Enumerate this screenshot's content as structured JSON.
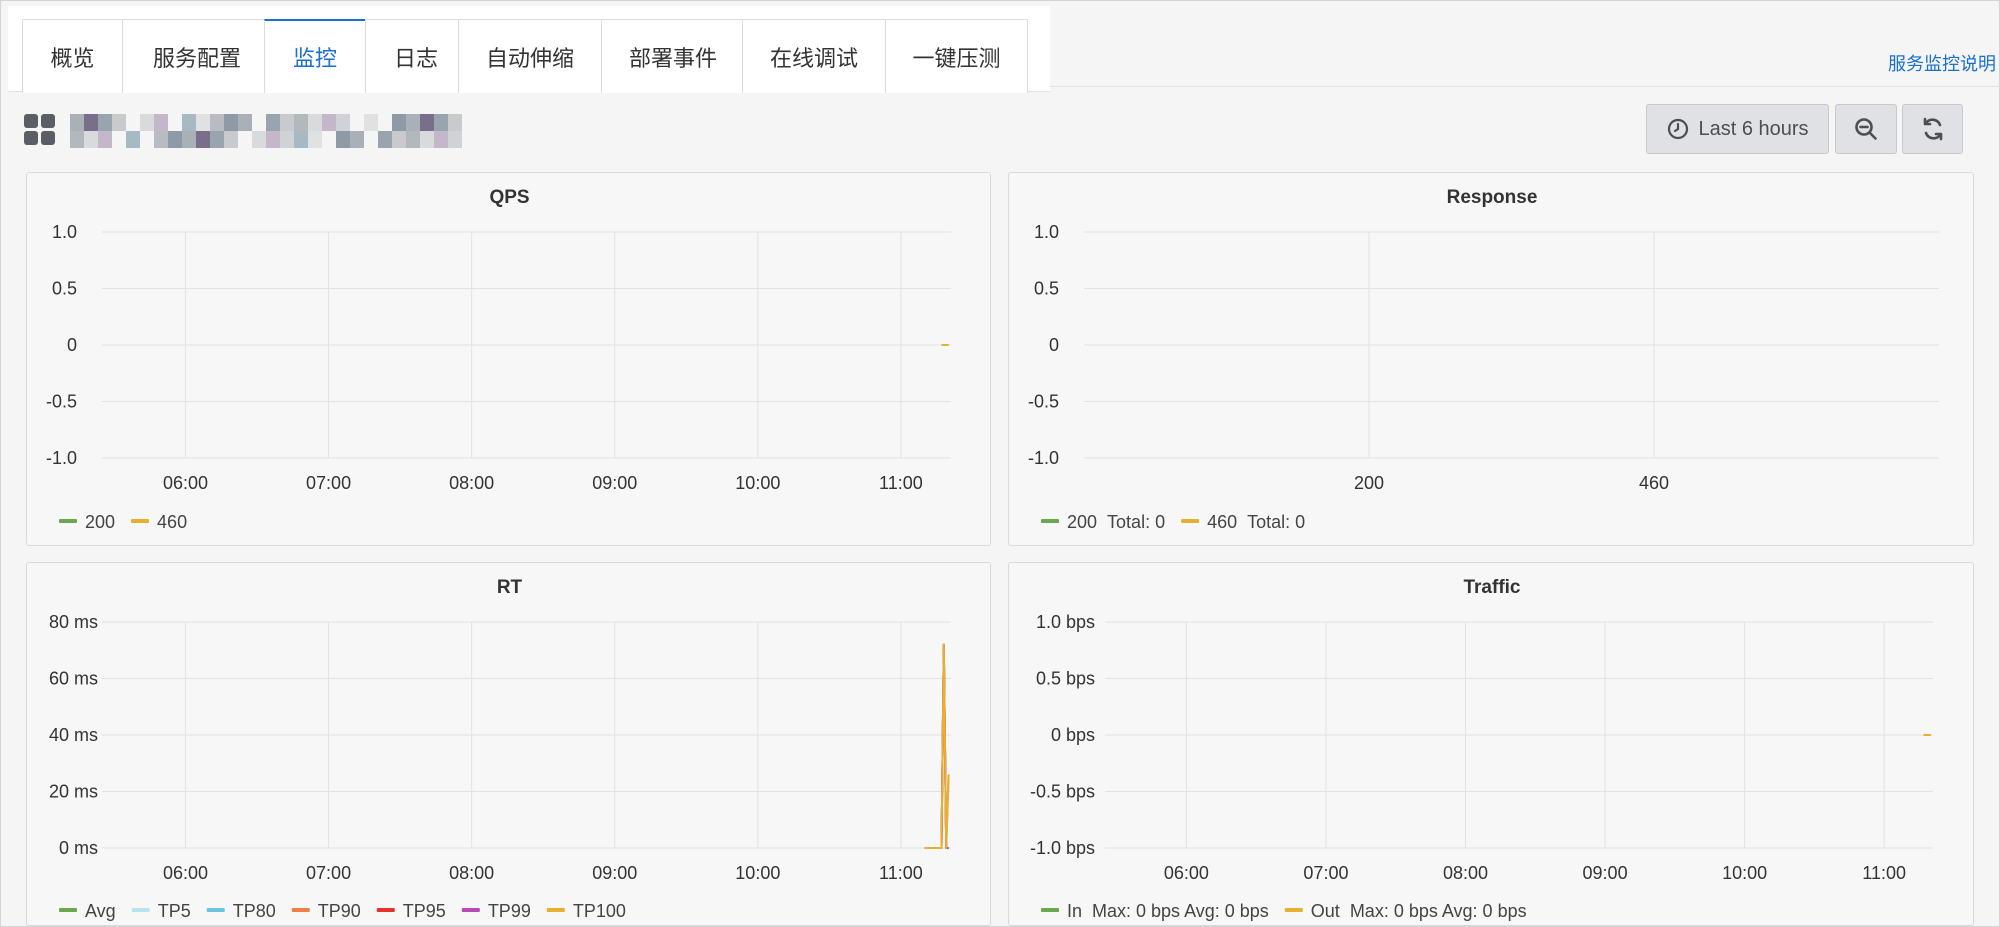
{
  "tabs": [
    {
      "label": "概览"
    },
    {
      "label": "服务配置"
    },
    {
      "label": "监控"
    },
    {
      "label": "日志"
    },
    {
      "label": "自动伸缩"
    },
    {
      "label": "部署事件"
    },
    {
      "label": "在线调试"
    },
    {
      "label": "一键压测"
    }
  ],
  "active_tab": "监控",
  "help_link": "服务监控说明",
  "toolbar": {
    "time_range_label": "Last 6 hours",
    "time_range_icon": "clock-icon",
    "zoom_out_icon": "zoom-out-icon",
    "refresh_icon": "refresh-icon"
  },
  "colors": {
    "accent": "#1a6fd1",
    "s200": "#6aa84f",
    "s460": "#e8b030",
    "avg": "#6aa84f",
    "tp5": "#b9e2f1",
    "tp80": "#6cc5e0",
    "tp90": "#ec8147",
    "tp95": "#e0342d",
    "tp99": "#b84ab7",
    "tp100": "#e8b030"
  },
  "chart_data": [
    {
      "title": "QPS",
      "type": "line",
      "x_ticks": [
        "06:00",
        "07:00",
        "08:00",
        "09:00",
        "10:00",
        "11:00"
      ],
      "y_ticks": [
        "1.0",
        "0.5",
        "0",
        "-0.5",
        "-1.0"
      ],
      "ylim": [
        -1.0,
        1.0
      ],
      "grid": true,
      "legend_position": "bottom-left",
      "series": [
        {
          "name": "200",
          "color": "#6aa84f",
          "x": [
            "11:17",
            "11:20"
          ],
          "y": [
            0,
            0
          ]
        },
        {
          "name": "460",
          "color": "#e8b030",
          "x": [
            "11:17",
            "11:20"
          ],
          "y": [
            0,
            0
          ]
        }
      ]
    },
    {
      "title": "Response",
      "type": "bar",
      "categories": [
        "200",
        "460"
      ],
      "y_ticks": [
        "1.0",
        "0.5",
        "0",
        "-0.5",
        "-1.0"
      ],
      "ylim": [
        -1.0,
        1.0
      ],
      "grid": true,
      "legend_position": "bottom-left",
      "series": [
        {
          "name": "200",
          "color": "#6aa84f",
          "total": "Total: 0",
          "values": [
            0,
            0
          ]
        },
        {
          "name": "460",
          "color": "#e8b030",
          "total": "Total: 0",
          "values": [
            0,
            0
          ]
        }
      ]
    },
    {
      "title": "RT",
      "type": "line",
      "x_ticks": [
        "06:00",
        "07:00",
        "08:00",
        "09:00",
        "10:00",
        "11:00"
      ],
      "y_ticks": [
        "80 ms",
        "60 ms",
        "40 ms",
        "20 ms",
        "0 ms"
      ],
      "ylim": [
        0,
        80
      ],
      "grid": true,
      "legend_position": "bottom-left",
      "series": [
        {
          "name": "Avg",
          "color": "#6aa84f",
          "x": [
            "11:10",
            "11:17",
            "11:18",
            "11:19",
            "11:20"
          ],
          "y": [
            0,
            0,
            72,
            0,
            0
          ]
        },
        {
          "name": "TP5",
          "color": "#b9e2f1",
          "x": [
            "11:10",
            "11:17",
            "11:18",
            "11:19",
            "11:20"
          ],
          "y": [
            0,
            0,
            70,
            0,
            0
          ]
        },
        {
          "name": "TP80",
          "color": "#6cc5e0",
          "x": [
            "11:10",
            "11:17",
            "11:18",
            "11:19",
            "11:20"
          ],
          "y": [
            0,
            0,
            71,
            0,
            0
          ]
        },
        {
          "name": "TP90",
          "color": "#ec8147",
          "x": [
            "11:10",
            "11:17",
            "11:18",
            "11:19",
            "11:20"
          ],
          "y": [
            0,
            0,
            72,
            0,
            26
          ]
        },
        {
          "name": "TP95",
          "color": "#e0342d",
          "x": [
            "11:10",
            "11:17",
            "11:18",
            "11:19",
            "11:20"
          ],
          "y": [
            0,
            0,
            72,
            0,
            0
          ]
        },
        {
          "name": "TP99",
          "color": "#b84ab7",
          "x": [
            "11:10",
            "11:17",
            "11:18",
            "11:19",
            "11:20"
          ],
          "y": [
            0,
            0,
            72,
            0,
            0
          ]
        },
        {
          "name": "TP100",
          "color": "#e8b030",
          "x": [
            "11:10",
            "11:17",
            "11:18",
            "11:19",
            "11:20"
          ],
          "y": [
            0,
            0,
            72,
            0,
            26
          ]
        }
      ]
    },
    {
      "title": "Traffic",
      "type": "line",
      "x_ticks": [
        "06:00",
        "07:00",
        "08:00",
        "09:00",
        "10:00",
        "11:00"
      ],
      "y_ticks": [
        "1.0 bps",
        "0.5 bps",
        "0 bps",
        "-0.5 bps",
        "-1.0 bps"
      ],
      "ylim": [
        -1.0,
        1.0
      ],
      "grid": true,
      "legend_position": "bottom-left",
      "series": [
        {
          "name": "In",
          "color": "#6aa84f",
          "stats": "Max: 0 bps  Avg: 0 bps",
          "x": [
            "11:17",
            "11:20"
          ],
          "y": [
            0,
            0
          ]
        },
        {
          "name": "Out",
          "color": "#e8b030",
          "stats": "Max: 0 bps  Avg: 0 bps",
          "x": [
            "11:17",
            "11:20"
          ],
          "y": [
            0,
            0
          ]
        }
      ]
    }
  ]
}
